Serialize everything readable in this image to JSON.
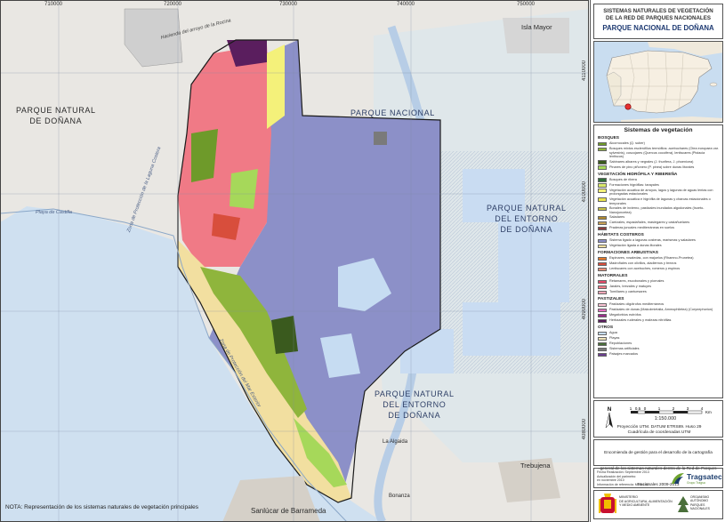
{
  "grid": {
    "x_labels": [
      "710000",
      "720000",
      "730000",
      "740000",
      "750000"
    ],
    "y_labels": [
      "4110000",
      "4100000",
      "4090000",
      "4080000"
    ]
  },
  "map_labels": {
    "parque_natural_donana_west": "PARQUE NATURAL\nDE DOÑANA",
    "parque_nacional": "PARQUE NACIONAL",
    "pn_entorno_east": "PARQUE NATURAL\nDEL ENTORNO\nDE DOÑANA",
    "pn_entorno_south": "PARQUE NATURAL\nDEL ENTORNO\nDE DOÑANA",
    "isla_mayor": "Isla Mayor",
    "sanlucar": "Sanlúcar de Barrameda",
    "trebujena": "Trebujena",
    "bonanza": "Bonanza",
    "la_algaida": "La Algaida",
    "zona_proteccion_1": "Zona de Protección de la Laguna Costera",
    "zona_proteccion_2": "Zona de Protección del Mar Exterior",
    "el_rocio": "Hacienda del arroyo de la Rocina",
    "playa_matalascanas": "Playa de Castilla",
    "note": "NOTA: Representación de los sistemas naturales de vegetación principales"
  },
  "panel": {
    "title_line1": "SISTEMAS NATURALES DE VEGETACIÓN",
    "title_line2": "DE LA RED DE PARQUES NACIONALES",
    "title_line3": "PARQUE NACIONAL DE DOÑANA",
    "legend_title": "Sistemas de vegetación",
    "legend": [
      {
        "section": "BOSQUES",
        "items": [
          {
            "label": "Alcornocales (Q. suber)",
            "color": "#6e9a2a"
          },
          {
            "label": "Bosques mixtos esclerófilos termófilos: acebuchares (Olea europaea var. sylvestris), coscojares (Quercus coccifera), lentiscares (Pistacia lentiscus)",
            "color": "#8fb53c"
          },
          {
            "label": "Sabinares albares y negrales (J. thurifera, J. phoenicea)",
            "color": "#3a5a1e"
          },
          {
            "label": "Pinares de pino piñonero (P. pinea) sobre dunas litorales",
            "color": "#a6d85a"
          }
        ]
      },
      {
        "section": "VEGETACIÓN HIDRÓFILA Y RIBEREÑA",
        "items": [
          {
            "label": "Bosques de ribera",
            "color": "#2f6e3a"
          },
          {
            "label": "Formaciones higrófilas: tarayales",
            "color": "#d9e86a"
          },
          {
            "label": "Vegetación acuática de arroyos, lagos y lagunas de aguas lentas con prolongadas estacionales",
            "color": "#f4f17a"
          },
          {
            "label": "Vegetación acuática e higrófila de lagunas y charcas estacionales o temporales",
            "color": "#e9e34c"
          },
          {
            "label": "Bonales de invierno, pastizales inundados algodonales (Isoeto-Nanojuncetea)",
            "color": "#c9c447"
          },
          {
            "label": "Saladares",
            "color": "#b08a2e"
          },
          {
            "label": "Carrizales, espadañales, masiegares y castañuelares",
            "color": "#c7a055"
          },
          {
            "label": "Praderas juncales mediterráneas en suelos",
            "color": "#8c3d3d"
          }
        ]
      },
      {
        "section": "HÁBITATS COSTEROS",
        "items": [
          {
            "label": "Sistema ligado a lagunas costeras, marismas y saladares",
            "color": "#8c90c8"
          },
          {
            "label": "Vegetación ligada a dunas litorales",
            "color": "#f2dfa0"
          }
        ]
      },
      {
        "section": "FORMACIONES ARBUSTIVAS",
        "items": [
          {
            "label": "Espinares, rosaledas, con majuelos (Rhamno-Prunetea)",
            "color": "#e57a2a"
          },
          {
            "label": "Madroñales con olivillos, aladiernos y brezos",
            "color": "#d84e3c"
          },
          {
            "label": "Lentiscares con acebuches, romeros y espinos",
            "color": "#e8907a"
          }
        ]
      },
      {
        "section": "MATORRALES",
        "items": [
          {
            "label": "Retamares, escobonales y piornales",
            "color": "#e64a6a"
          },
          {
            "label": "Jarales, brezales y matuyes",
            "color": "#f07a86"
          },
          {
            "label": "Tomillares y cantuesares",
            "color": "#f4a7b8"
          }
        ]
      },
      {
        "section": "PASTIZALES",
        "items": [
          {
            "label": "Pastizales oligótrofos mediterráneos",
            "color": "#f8c4d4"
          },
          {
            "label": "Pastizales de dunas (Malcolmietalia, Ammophiletea) (Corynephorion)",
            "color": "#e26bbf"
          },
          {
            "label": "Megaforbios eutrófos",
            "color": "#9b2d8a"
          },
          {
            "label": "Herbazales ruderales y malezas nitrófilas",
            "color": "#5a1e5e"
          }
        ]
      },
      {
        "section": "OTROS",
        "items": [
          {
            "label": "Agua",
            "color": "#c6dcf2"
          },
          {
            "label": "Playas",
            "color": "#efe2b8"
          },
          {
            "label": "Repoblaciones",
            "color": "#4a6f3a"
          },
          {
            "label": "Sistemas artificiales",
            "color": "#7a7a7a"
          },
          {
            "label": "Paisajes marcados",
            "color": "#6a3d8f"
          }
        ]
      }
    ],
    "scale_ticks": [
      "1",
      "0.5",
      "0",
      "1",
      "2",
      "3",
      "4"
    ],
    "scale_unit": "Km",
    "scale_ratio": "1:150.000",
    "projection_line1": "Proyección UTM. DATUM ETRS89. Huso 29",
    "projection_line2": "Cuadrícula de coordenadas UTM",
    "credits": "Encomienda de gestión para el desarrollo de la cartografía general de los sistemas naturales dentro de la Red de Parques Nacionales 2009-2013",
    "meta_line1": "Fecha Realización: Septiembre 2013",
    "meta_line2": "Actualización del parimetro:",
    "meta_line3": "en noviembre 2010",
    "meta_line4": "Información de referencia: MTN 1:50",
    "tragsatec": "Tragsatec",
    "tragsatec_sub": "Grupo Tragsa",
    "ministerio": "MINISTERIO\nDE AGRICULTURA, ALIMENTACIÓN\nY MEDIO AMBIENTE",
    "organismo": "ORGANISMO\nAUTÓNOMO\nPARQUES\nNACIONALES"
  }
}
